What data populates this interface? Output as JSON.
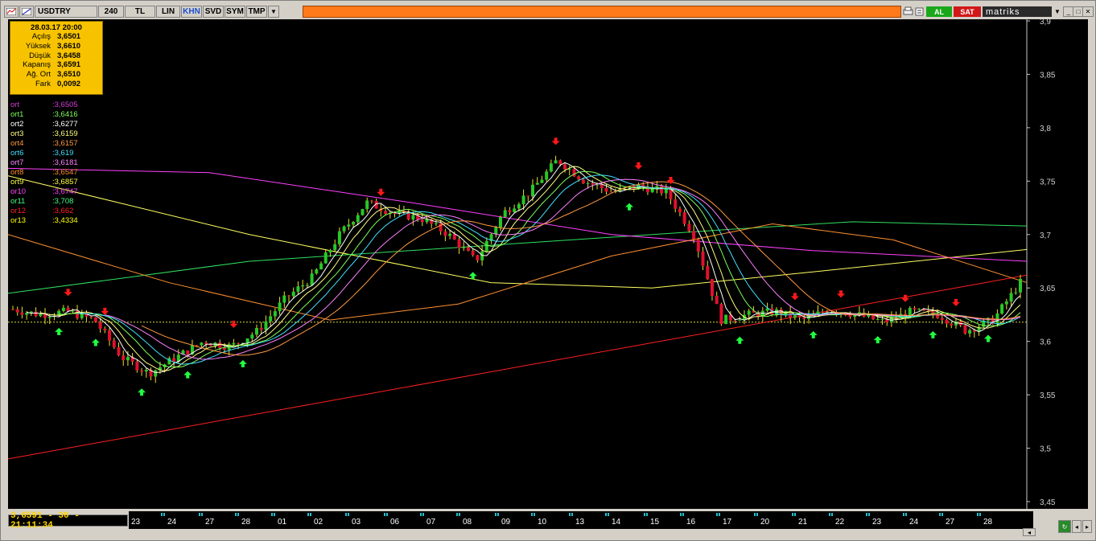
{
  "toolbar": {
    "symbol": "USDTRY",
    "period": "240",
    "buttons": [
      "TL",
      "LIN",
      "KHN",
      "SVD",
      "SYM",
      "TMP"
    ],
    "active_button": "KHN",
    "al": "AL",
    "sat": "SAT",
    "brand": "matriks"
  },
  "info": {
    "datetime": "28.03.17 20:00",
    "rows": [
      {
        "label": "Açılış",
        "value": "3,6501"
      },
      {
        "label": "Yüksek",
        "value": "3,6610"
      },
      {
        "label": "Düşük",
        "value": "3,6458"
      },
      {
        "label": "Kapanış",
        "value": "3,6591"
      },
      {
        "label": "Ağ. Ort",
        "value": "3,6510"
      },
      {
        "label": "Fark",
        "value": "0,0092"
      }
    ]
  },
  "legend": [
    {
      "name": "ort",
      "value": ":3,6505",
      "color": "#d43cd4"
    },
    {
      "name": "ort1",
      "value": ":3,6416",
      "color": "#7cff5a"
    },
    {
      "name": "ort2",
      "value": ":3,6277",
      "color": "#ffffff"
    },
    {
      "name": "ort3",
      "value": ":3,6159",
      "color": "#ffff80"
    },
    {
      "name": "ort4",
      "value": ":3,6157",
      "color": "#ff9a40"
    },
    {
      "name": "ort6",
      "value": ":3,619",
      "color": "#40e0ff"
    },
    {
      "name": "ort7",
      "value": ":3,6181",
      "color": "#ff80ff"
    },
    {
      "name": "ort8",
      "value": ":3,6547",
      "color": "#ff8c28"
    },
    {
      "name": "ort9",
      "value": ":3,6857",
      "color": "#ffff40"
    },
    {
      "name": "or10",
      "value": ":3,6747",
      "color": "#ff40ff"
    },
    {
      "name": "or11",
      "value": ":3,708",
      "color": "#40ff80"
    },
    {
      "name": "or12",
      "value": ":3,662",
      "color": "#ff2020"
    },
    {
      "name": "or13",
      "value": ":3,4334",
      "color": "#ffff00"
    }
  ],
  "y_ticks": [
    {
      "label": "3,9",
      "v": 3.9
    },
    {
      "label": "3,85",
      "v": 3.85
    },
    {
      "label": "3,8",
      "v": 3.8
    },
    {
      "label": "3,75",
      "v": 3.75
    },
    {
      "label": "3,7",
      "v": 3.7
    },
    {
      "label": "3,65",
      "v": 3.65
    },
    {
      "label": "3,6",
      "v": 3.6
    },
    {
      "label": "3,55",
      "v": 3.55
    },
    {
      "label": "3,5",
      "v": 3.5
    },
    {
      "label": "3,45",
      "v": 3.45
    }
  ],
  "x_labels": [
    "23",
    "24",
    "27",
    "28",
    "01",
    "02",
    "03",
    "06",
    "07",
    "08",
    "09",
    "10",
    "13",
    "14",
    "15",
    "16",
    "17",
    "20",
    "21",
    "22",
    "23",
    "24",
    "27",
    "28"
  ],
  "status": "3,6591 - 30 - 21:11:34",
  "chart_data": {
    "type": "candlestick",
    "ylim": [
      3.45,
      3.9
    ],
    "x": [
      "23",
      "24",
      "27",
      "28",
      "01",
      "02",
      "03",
      "06",
      "07",
      "08",
      "09",
      "10",
      "13",
      "14",
      "15",
      "16",
      "17",
      "20",
      "21",
      "22",
      "23",
      "24",
      "27",
      "28"
    ],
    "close_path": [
      3.63,
      3.625,
      3.628,
      3.62,
      3.585,
      3.57,
      3.585,
      3.6,
      3.595,
      3.61,
      3.64,
      3.66,
      3.7,
      3.73,
      3.72,
      3.715,
      3.7,
      3.675,
      3.72,
      3.74,
      3.77,
      3.75,
      3.74,
      3.745,
      3.74,
      3.7,
      3.62,
      3.625,
      3.628,
      3.62,
      3.63,
      3.625,
      3.618,
      3.628,
      3.625,
      3.61,
      3.62,
      3.655
    ]
  },
  "colors": {
    "background": "#000000",
    "up": "#28c828",
    "down": "#e01030",
    "toolbar_orange": "#ff7a1a",
    "status_text": "#ffd400"
  }
}
